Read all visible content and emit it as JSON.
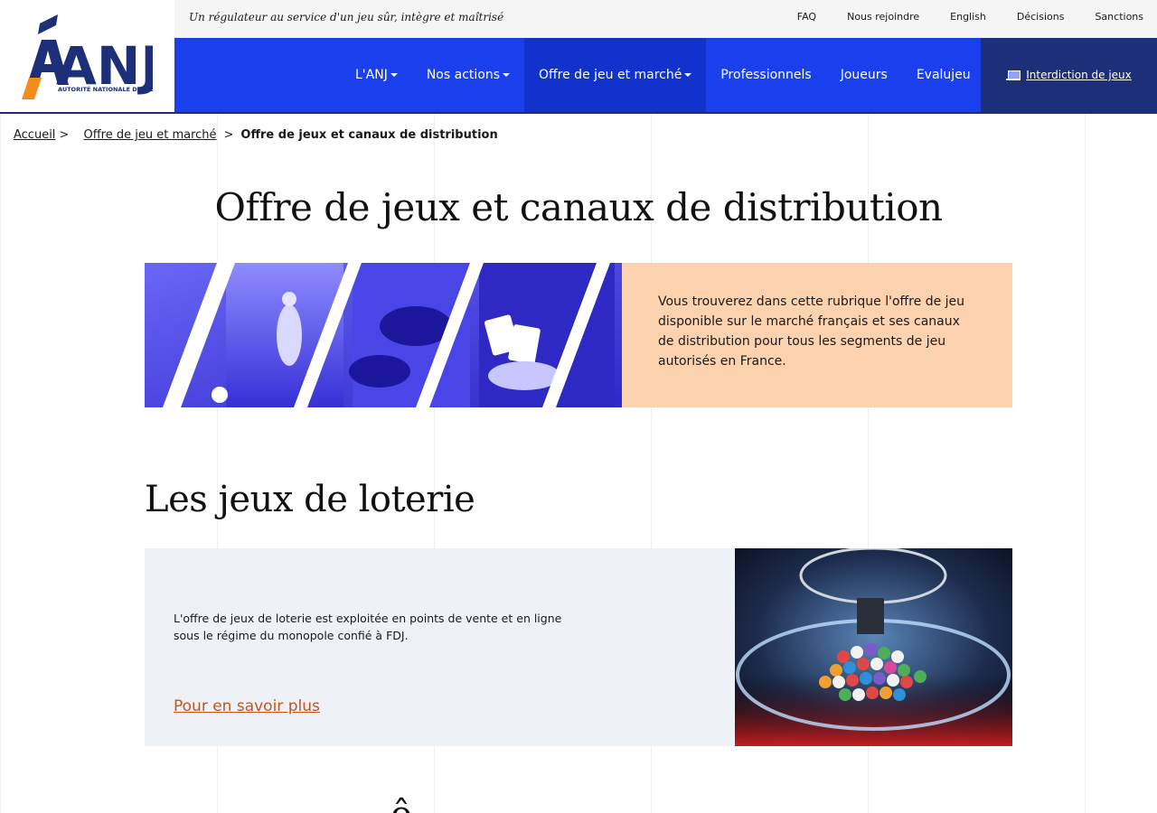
{
  "header": {
    "logo_text": "ANJ",
    "logo_subtitle": "AUTORITÉ NATIONALE DES JEUX",
    "tagline": "Un régulateur au service d'un jeu sûr, intègre et maîtrisé",
    "top_links": [
      "FAQ",
      "Nous rejoindre",
      "English",
      "Décisions",
      "Sanctions"
    ],
    "nav": [
      {
        "label": "L'ANJ",
        "dropdown": true
      },
      {
        "label": "Nos actions",
        "dropdown": true
      },
      {
        "label": "Offre de jeu et marché",
        "dropdown": true,
        "active": true
      },
      {
        "label": "Professionnels",
        "dropdown": false
      },
      {
        "label": "Joueurs",
        "dropdown": false
      },
      {
        "label": "Evalujeu",
        "dropdown": false
      }
    ],
    "cta_label": "Interdiction de jeux",
    "cta_icon": "laptop-icon"
  },
  "breadcrumb": {
    "home": "Accueil",
    "parent": "Offre de jeu et marché",
    "current": "Offre de jeux et canaux de distribution",
    "separator": ">"
  },
  "page_title": "Offre de jeux et canaux de distribution",
  "hero": {
    "text": "Vous trouverez dans cette rubrique l'offre de jeu disponible sur le marché français et ses canaux de distribution pour tous les segments de jeu autorisés en France."
  },
  "lottery": {
    "title": "Les jeux de loterie",
    "text": "L'offre de jeux de loterie est exploitée en points de vente et en ligne sous le régime du monopole confié à FDJ.",
    "link": "Pour en savoir plus"
  },
  "next_heading": "ô",
  "colors": {
    "nav_blue": "#1a40ee",
    "nav_active": "#1232cc",
    "navy": "#1d2f78",
    "peach": "#fdd2af",
    "orange_link": "#c4561a",
    "logo_orange": "#f28c1b"
  }
}
